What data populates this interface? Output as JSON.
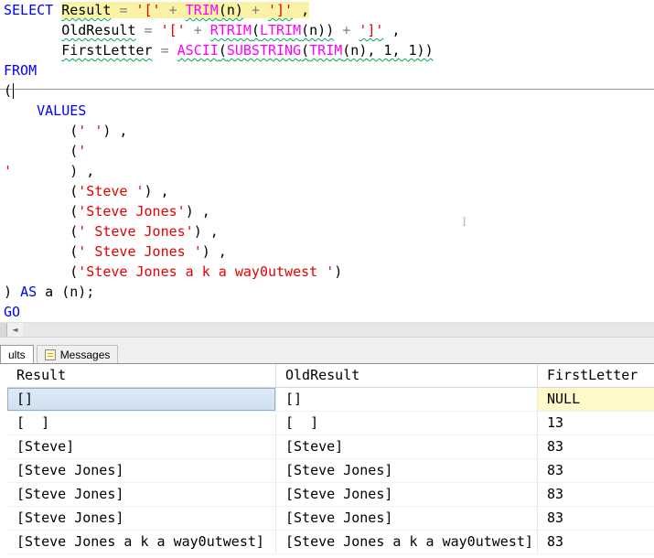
{
  "editor": {
    "lines": [
      [
        {
          "t": "SELECT ",
          "c": "kw"
        },
        {
          "t": "Result",
          "c": "id",
          "sq": 1,
          "hl": 1
        },
        {
          "t": " ",
          "c": "id",
          "hl": 1
        },
        {
          "t": "=",
          "c": "op",
          "hl": 1
        },
        {
          "t": " ",
          "c": "id",
          "hl": 1
        },
        {
          "t": "'['",
          "c": "str",
          "hl": 1
        },
        {
          "t": " ",
          "c": "id",
          "hl": 1
        },
        {
          "t": "+",
          "c": "op",
          "hl": 1
        },
        {
          "t": " ",
          "c": "id",
          "hl": 1
        },
        {
          "t": "TRIM",
          "c": "fn",
          "sq": 1,
          "hl": 1
        },
        {
          "t": "(n)",
          "c": "id",
          "sq": 1,
          "hl": 1
        },
        {
          "t": " ",
          "c": "id",
          "hl": 1
        },
        {
          "t": "+",
          "c": "op",
          "hl": 1
        },
        {
          "t": " ",
          "c": "id",
          "hl": 1
        },
        {
          "t": "']'",
          "c": "str",
          "sq": 1,
          "hl": 1
        },
        {
          "t": " ,",
          "c": "id",
          "hl": 1
        }
      ],
      [
        {
          "t": "       ",
          "c": "id"
        },
        {
          "t": "OldResult",
          "c": "id",
          "sq": 1
        },
        {
          "t": " ",
          "c": "id"
        },
        {
          "t": "=",
          "c": "op"
        },
        {
          "t": " ",
          "c": "id"
        },
        {
          "t": "'['",
          "c": "str"
        },
        {
          "t": " ",
          "c": "id"
        },
        {
          "t": "+",
          "c": "op"
        },
        {
          "t": " ",
          "c": "id"
        },
        {
          "t": "RTRIM",
          "c": "fn",
          "sq": 1
        },
        {
          "t": "(",
          "c": "id",
          "sq": 1
        },
        {
          "t": "LTRIM",
          "c": "fn",
          "sq": 1
        },
        {
          "t": "(n))",
          "c": "id",
          "sq": 1
        },
        {
          "t": " ",
          "c": "id"
        },
        {
          "t": "+",
          "c": "op"
        },
        {
          "t": " ",
          "c": "id"
        },
        {
          "t": "']'",
          "c": "str",
          "sq": 1
        },
        {
          "t": " ,",
          "c": "id"
        }
      ],
      [
        {
          "t": "       ",
          "c": "id"
        },
        {
          "t": "FirstLetter",
          "c": "id",
          "sq": 1
        },
        {
          "t": " ",
          "c": "id"
        },
        {
          "t": "=",
          "c": "op"
        },
        {
          "t": " ",
          "c": "id"
        },
        {
          "t": "ASCII",
          "c": "fn",
          "sq": 1
        },
        {
          "t": "(",
          "c": "id",
          "sq": 1
        },
        {
          "t": "SUBSTRING",
          "c": "fn",
          "sq": 1
        },
        {
          "t": "(",
          "c": "id",
          "sq": 1
        },
        {
          "t": "TRIM",
          "c": "fn",
          "sq": 1
        },
        {
          "t": "(n), 1, 1))",
          "c": "id",
          "sq": 1
        }
      ],
      [
        {
          "t": "FROM",
          "c": "kw"
        }
      ],
      [
        {
          "t": "(",
          "c": "id",
          "caret": 1
        }
      ],
      [
        {
          "t": "    ",
          "c": "id"
        },
        {
          "t": "VALUES",
          "c": "kw"
        }
      ],
      [
        {
          "t": "        (",
          "c": "id"
        },
        {
          "t": "' '",
          "c": "str"
        },
        {
          "t": ") ,",
          "c": "id"
        }
      ],
      [
        {
          "t": "        (",
          "c": "id"
        },
        {
          "t": "'",
          "c": "str"
        }
      ],
      [
        {
          "t": "'",
          "c": "str"
        },
        {
          "t": "       ",
          "c": "id"
        },
        {
          "t": ") ,",
          "c": "id"
        }
      ],
      [
        {
          "t": "        (",
          "c": "id"
        },
        {
          "t": "'Steve '",
          "c": "str"
        },
        {
          "t": ") ,",
          "c": "id"
        }
      ],
      [
        {
          "t": "        (",
          "c": "id"
        },
        {
          "t": "'Steve Jones'",
          "c": "str"
        },
        {
          "t": ") ,",
          "c": "id"
        }
      ],
      [
        {
          "t": "        (",
          "c": "id"
        },
        {
          "t": "' Steve Jones'",
          "c": "str"
        },
        {
          "t": ") ,",
          "c": "id"
        }
      ],
      [
        {
          "t": "        (",
          "c": "id"
        },
        {
          "t": "' Steve Jones '",
          "c": "str"
        },
        {
          "t": ") ,",
          "c": "id"
        }
      ],
      [
        {
          "t": "        (",
          "c": "id"
        },
        {
          "t": "'Steve Jones a k a way0utwest '",
          "c": "str"
        },
        {
          "t": ")",
          "c": "id"
        }
      ],
      [
        {
          "t": ") ",
          "c": "id"
        },
        {
          "t": "AS",
          "c": "kw"
        },
        {
          "t": " a (n);",
          "c": "id"
        }
      ],
      [
        {
          "t": "GO",
          "c": "kw"
        }
      ]
    ]
  },
  "scrollbar": {
    "left_arrow": "◄"
  },
  "tabs": {
    "results_label": "ults",
    "messages_label": "Messages"
  },
  "grid": {
    "columns": [
      "Result",
      "OldResult",
      "FirstLetter"
    ],
    "rows": [
      [
        "[]",
        "[]",
        "NULL"
      ],
      [
        "[  ]",
        "[  ]",
        "13"
      ],
      [
        "[Steve]",
        "[Steve]",
        "83"
      ],
      [
        "[Steve Jones]",
        "[Steve Jones]",
        "83"
      ],
      [
        "[Steve Jones]",
        "[Steve Jones]",
        "83"
      ],
      [
        "[Steve Jones]",
        "[Steve Jones]",
        "83"
      ],
      [
        "[Steve Jones a k a way0utwest]",
        "[Steve Jones a k a way0utwest]",
        "83"
      ]
    ],
    "selected_cell": {
      "row": 0,
      "col": 0
    },
    "null_cells": [
      {
        "row": 0,
        "col": 2
      }
    ]
  },
  "cursor_artifact": {
    "glyph": "I"
  },
  "colors": {
    "keyword": "#0000ff",
    "identifier": "#000000",
    "string": "#e60000",
    "function": "#ff00ff",
    "operator": "#808080",
    "squiggle": "#00a650",
    "statement-highlight": "#faf3a6",
    "selected-cell-border": "#8cb0d2",
    "null-cell-bg": "#fff8c9"
  }
}
